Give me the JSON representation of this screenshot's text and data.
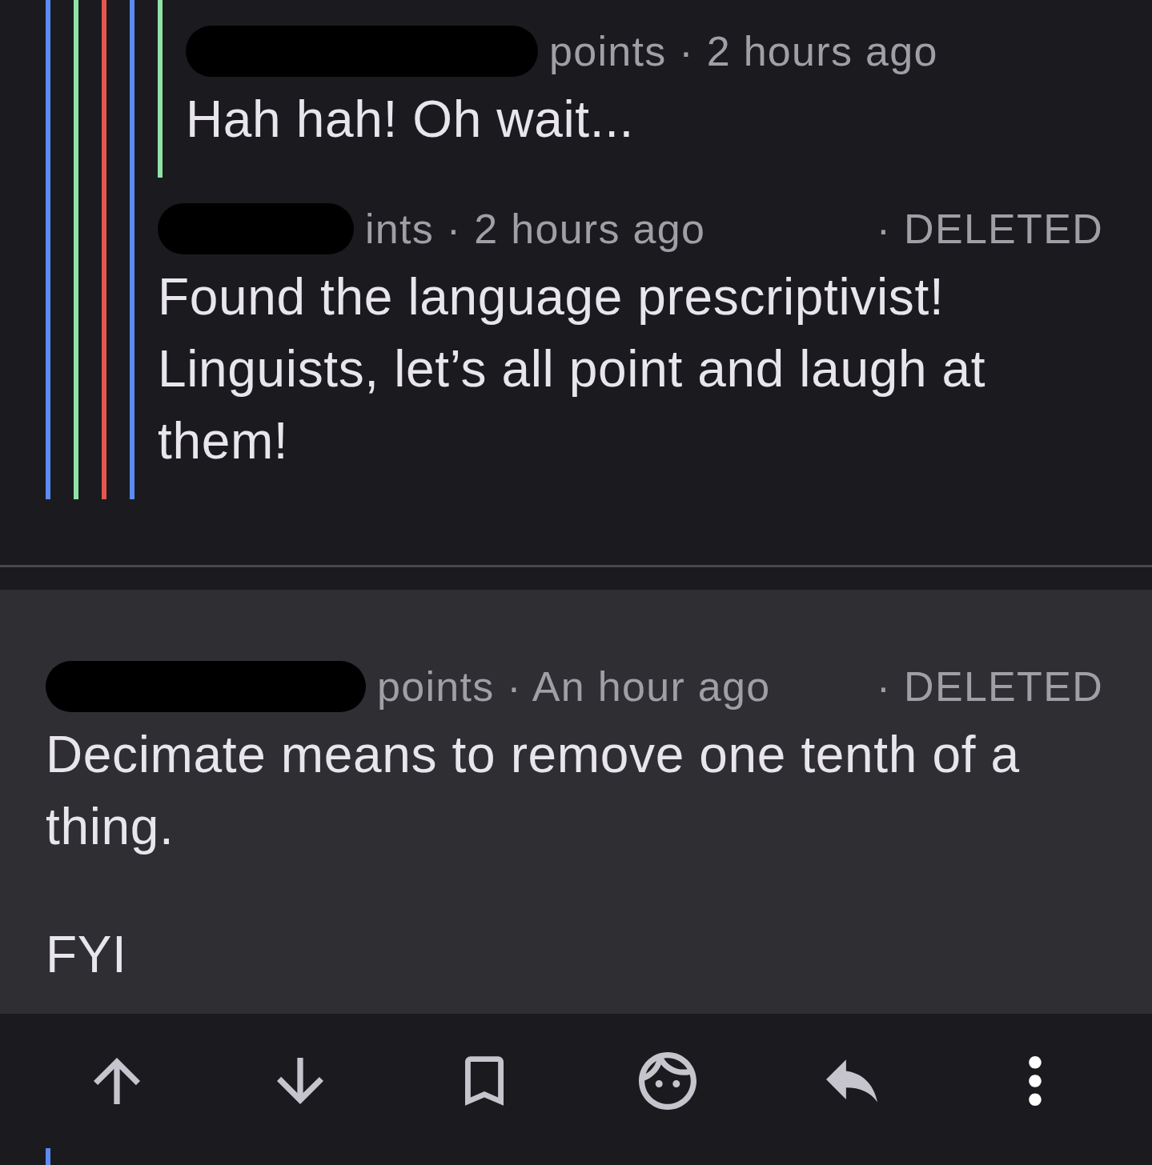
{
  "threads": [
    {
      "comments": [
        {
          "author_redacted": true,
          "thread_lines": [
            {
              "color": "#5b8cf2"
            },
            {
              "color": "#8ee3a5"
            },
            {
              "color": "#e5574e"
            },
            {
              "color": "#5b8cf2"
            },
            {
              "color": "#8ee3a5"
            }
          ],
          "meta": "points · 2 hours ago",
          "selected": false,
          "body": [
            "Hah hah! Oh wait..."
          ]
        },
        {
          "author_redacted": true,
          "thread_lines": [
            {
              "color": "#5b8cf2"
            },
            {
              "color": "#8ee3a5"
            },
            {
              "color": "#e5574e"
            },
            {
              "color": "#5b8cf2"
            }
          ],
          "meta": "ints · 2 hours ago",
          "status": "· DELETED",
          "selected": false,
          "body": [
            "Found the language prescriptivist! Linguists, let’s all point and laugh at them!"
          ]
        }
      ]
    },
    {
      "comments": [
        {
          "author_redacted": true,
          "meta": "points · An hour ago",
          "status": "· DELETED",
          "selected": true,
          "body": [
            "Decimate means to remove one tenth of a thing.",
            "FYI"
          ]
        }
      ]
    }
  ],
  "next_comment": {
    "thread_lines": [
      {
        "color": "#5b8cf2"
      }
    ]
  }
}
